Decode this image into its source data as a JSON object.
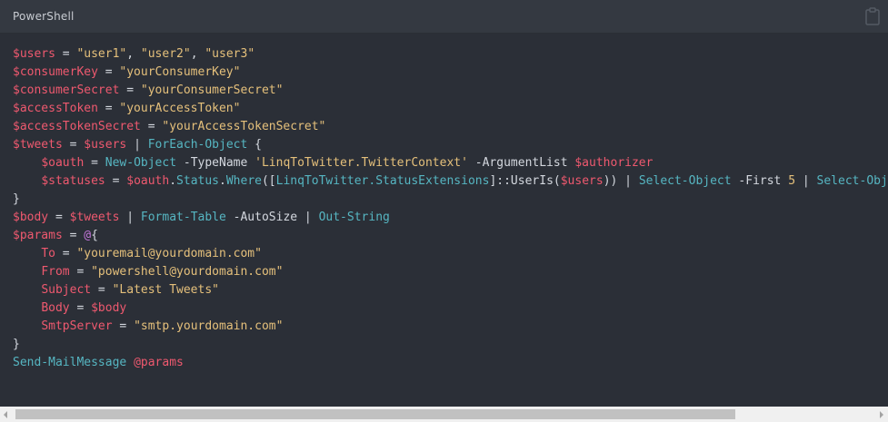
{
  "header": {
    "language": "PowerShell",
    "copy_icon": "clipboard-icon"
  },
  "colors": {
    "variable": "#ef596f",
    "string": "#e5c07b",
    "command": "#56b6c2",
    "keyword": "#c678dd",
    "plain": "#d4d8df",
    "background": "#2b2f37",
    "header_background": "#343941"
  },
  "code": {
    "lines": [
      [
        {
          "t": "v",
          "x": "$users"
        },
        {
          "t": "p",
          "x": " = "
        },
        {
          "t": "s",
          "x": "\"user1\""
        },
        {
          "t": "p",
          "x": ", "
        },
        {
          "t": "s",
          "x": "\"user2\""
        },
        {
          "t": "p",
          "x": ", "
        },
        {
          "t": "s",
          "x": "\"user3\""
        }
      ],
      [
        {
          "t": "v",
          "x": "$consumerKey"
        },
        {
          "t": "p",
          "x": " = "
        },
        {
          "t": "s",
          "x": "\"yourConsumerKey\""
        }
      ],
      [
        {
          "t": "v",
          "x": "$consumerSecret"
        },
        {
          "t": "p",
          "x": " = "
        },
        {
          "t": "s",
          "x": "\"yourConsumerSecret\""
        }
      ],
      [
        {
          "t": "v",
          "x": "$accessToken"
        },
        {
          "t": "p",
          "x": " = "
        },
        {
          "t": "s",
          "x": "\"yourAccessToken\""
        }
      ],
      [
        {
          "t": "v",
          "x": "$accessTokenSecret"
        },
        {
          "t": "p",
          "x": " = "
        },
        {
          "t": "s",
          "x": "\"yourAccessTokenSecret\""
        }
      ],
      [
        {
          "t": "v",
          "x": "$tweets"
        },
        {
          "t": "p",
          "x": " = "
        },
        {
          "t": "v",
          "x": "$users"
        },
        {
          "t": "p",
          "x": " | "
        },
        {
          "t": "c",
          "x": "ForEach-Object"
        },
        {
          "t": "p",
          "x": " {"
        }
      ],
      [
        {
          "t": "p",
          "x": "    "
        },
        {
          "t": "v",
          "x": "$oauth"
        },
        {
          "t": "p",
          "x": " = "
        },
        {
          "t": "c",
          "x": "New-Object"
        },
        {
          "t": "p",
          "x": " -TypeName "
        },
        {
          "t": "s",
          "x": "'LinqToTwitter.TwitterContext'"
        },
        {
          "t": "p",
          "x": " -ArgumentList "
        },
        {
          "t": "v",
          "x": "$authorizer"
        }
      ],
      [
        {
          "t": "p",
          "x": "    "
        },
        {
          "t": "v",
          "x": "$statuses"
        },
        {
          "t": "p",
          "x": " = "
        },
        {
          "t": "v",
          "x": "$oauth"
        },
        {
          "t": "p",
          "x": "."
        },
        {
          "t": "c",
          "x": "Status"
        },
        {
          "t": "p",
          "x": "."
        },
        {
          "t": "c",
          "x": "Where"
        },
        {
          "t": "p",
          "x": "(["
        },
        {
          "t": "c",
          "x": "LinqToTwitter.StatusExtensions"
        },
        {
          "t": "p",
          "x": "]::UserIs("
        },
        {
          "t": "v",
          "x": "$users"
        },
        {
          "t": "p",
          "x": ")) | "
        },
        {
          "t": "c",
          "x": "Select-Object"
        },
        {
          "t": "p",
          "x": " -First "
        },
        {
          "t": "s",
          "x": "5"
        },
        {
          "t": "p",
          "x": " | "
        },
        {
          "t": "c",
          "x": "Select-Objec"
        }
      ],
      [
        {
          "t": "p",
          "x": "}"
        }
      ],
      [
        {
          "t": "v",
          "x": "$body"
        },
        {
          "t": "p",
          "x": " = "
        },
        {
          "t": "v",
          "x": "$tweets"
        },
        {
          "t": "p",
          "x": " | "
        },
        {
          "t": "c",
          "x": "Format-Table"
        },
        {
          "t": "p",
          "x": " -AutoSize | "
        },
        {
          "t": "c",
          "x": "Out-String"
        }
      ],
      [
        {
          "t": "v",
          "x": "$params"
        },
        {
          "t": "p",
          "x": " = "
        },
        {
          "t": "k",
          "x": "@"
        },
        {
          "t": "p",
          "x": "{"
        }
      ],
      [
        {
          "t": "p",
          "x": "    "
        },
        {
          "t": "v",
          "x": "To"
        },
        {
          "t": "p",
          "x": " = "
        },
        {
          "t": "s",
          "x": "\"youremail@yourdomain.com\""
        }
      ],
      [
        {
          "t": "p",
          "x": "    "
        },
        {
          "t": "v",
          "x": "From"
        },
        {
          "t": "p",
          "x": " = "
        },
        {
          "t": "s",
          "x": "\"powershell@yourdomain.com\""
        }
      ],
      [
        {
          "t": "p",
          "x": "    "
        },
        {
          "t": "v",
          "x": "Subject"
        },
        {
          "t": "p",
          "x": " = "
        },
        {
          "t": "s",
          "x": "\"Latest Tweets\""
        }
      ],
      [
        {
          "t": "p",
          "x": "    "
        },
        {
          "t": "v",
          "x": "Body"
        },
        {
          "t": "p",
          "x": " = "
        },
        {
          "t": "v",
          "x": "$body"
        }
      ],
      [
        {
          "t": "p",
          "x": "    "
        },
        {
          "t": "v",
          "x": "SmtpServer"
        },
        {
          "t": "p",
          "x": " = "
        },
        {
          "t": "s",
          "x": "\"smtp.yourdomain.com\""
        }
      ],
      [
        {
          "t": "p",
          "x": "}"
        }
      ],
      [
        {
          "t": "c",
          "x": "Send-MailMessage"
        },
        {
          "t": "p",
          "x": " "
        },
        {
          "t": "v",
          "x": "@params"
        }
      ]
    ]
  },
  "scrollbar": {
    "left_arrow_icon": "chevron-left-icon",
    "right_arrow_icon": "chevron-right-icon",
    "visible_fraction": 0.84
  }
}
